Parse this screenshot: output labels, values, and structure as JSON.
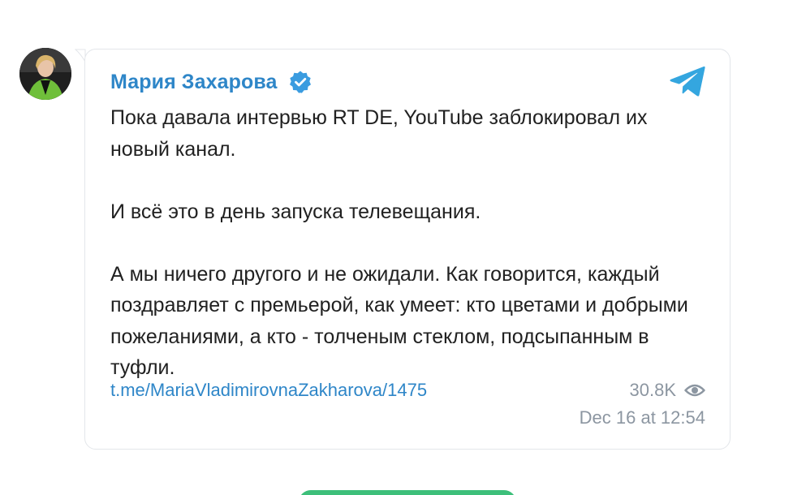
{
  "post": {
    "author_name": "Мария Захарова",
    "verified": true,
    "paragraphs": [
      "Пока давала интервью RT DE, YouTube заблокировал их новый канал.",
      "И всё это в день запуска телевещания.",
      "А мы ничего другого и не ожидали. Как говорится, каждый поздравляет с премьерой, как умеет: кто цветами и добрыми пожеланиями, а кто - толченым стеклом, подсыпанным в туфли."
    ],
    "link": "t.me/MariaVladimirovnaZakharova/1475",
    "views": "30.8K",
    "date": "Dec 16 at 12:54"
  },
  "icons": {
    "verified": "verified-badge-icon",
    "telegram": "telegram-logo-icon",
    "views": "eye-icon"
  },
  "colors": {
    "accent": "#2e86c8",
    "verified": "#3a9ce0",
    "telegram": "#34a6df",
    "text": "#212121",
    "meta": "#8c96a1",
    "border": "#e3e6ea",
    "bottom_button": "#3dbf7a"
  }
}
